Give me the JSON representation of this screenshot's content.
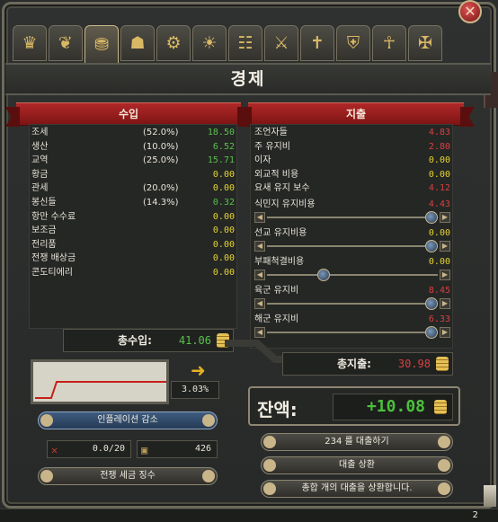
{
  "close_label": "✕",
  "tabs": [
    {
      "icon": "crown-icon",
      "glyph": "♛"
    },
    {
      "icon": "dove-icon",
      "glyph": "❦"
    },
    {
      "icon": "money-bag-icon",
      "glyph": "⛃"
    },
    {
      "icon": "trade-crate-icon",
      "glyph": "☗"
    },
    {
      "icon": "gears-icon",
      "glyph": "⚙"
    },
    {
      "icon": "lightbulb-icon",
      "glyph": "☀"
    },
    {
      "icon": "scroll-icon",
      "glyph": "☷"
    },
    {
      "icon": "arms-icon",
      "glyph": "⚔"
    },
    {
      "icon": "cross-icon",
      "glyph": "✝"
    },
    {
      "icon": "shield-icon",
      "glyph": "⛨"
    },
    {
      "icon": "royal-crest-icon",
      "glyph": "☥"
    },
    {
      "icon": "flag-cross-icon",
      "glyph": "✠"
    }
  ],
  "title": "경제",
  "income": {
    "header": "수입",
    "rows": [
      {
        "label": "조세",
        "pct": "(52.0%)",
        "value": "18.50",
        "color": "green"
      },
      {
        "label": "생산",
        "pct": "(10.0%)",
        "value": "6.52",
        "color": "green"
      },
      {
        "label": "교역",
        "pct": "(25.0%)",
        "value": "15.71",
        "color": "green"
      },
      {
        "label": "황금",
        "pct": "",
        "value": "0.00",
        "color": "yellow"
      },
      {
        "label": "관세",
        "pct": "(20.0%)",
        "value": "0.00",
        "color": "yellow"
      },
      {
        "label": "봉신들",
        "pct": "(14.3%)",
        "value": "0.32",
        "color": "green"
      },
      {
        "label": "항만 수수료",
        "pct": "",
        "value": "0.00",
        "color": "yellow"
      },
      {
        "label": "보조금",
        "pct": "",
        "value": "0.00",
        "color": "yellow"
      },
      {
        "label": "전리품",
        "pct": "",
        "value": "0.00",
        "color": "yellow"
      },
      {
        "label": "전쟁 배상금",
        "pct": "",
        "value": "0.00",
        "color": "yellow"
      },
      {
        "label": "콘도티에리",
        "pct": "",
        "value": "0.00",
        "color": "yellow"
      }
    ],
    "total_label": "총수입:",
    "total_value": "41.06"
  },
  "expense": {
    "header": "지출",
    "rows": [
      {
        "label": "조언자들",
        "value": "4.83",
        "color": "red"
      },
      {
        "label": "주 유지비",
        "value": "2.80",
        "color": "red"
      },
      {
        "label": "이자",
        "value": "0.00",
        "color": "yellow"
      },
      {
        "label": "외교적 비용",
        "value": "0.00",
        "color": "yellow"
      },
      {
        "label": "요새 유지 보수",
        "value": "4.12",
        "color": "red"
      }
    ],
    "slider_rows": [
      {
        "label": "식민지 유지비용",
        "value": "4.43",
        "color": "red",
        "level": 1.0
      },
      {
        "label": "선교 유지비용",
        "value": "0.00",
        "color": "yellow",
        "level": 1.0
      },
      {
        "label": "부패척결비용",
        "value": "0.00",
        "color": "yellow",
        "level": 0.32
      },
      {
        "label": "육군 유지비",
        "value": "8.45",
        "color": "red",
        "level": 1.0
      },
      {
        "label": "해군 유지비",
        "value": "6.33",
        "color": "red",
        "level": 1.0
      }
    ],
    "total_label": "총지출:",
    "total_value": "30.98"
  },
  "inflation": {
    "value": "3.03%",
    "button_label": "인플레이션 감소"
  },
  "balance": {
    "label": "잔액:",
    "value": "+10.08"
  },
  "corruption": {
    "value": "0.0/20"
  },
  "loan_size": {
    "value": "426"
  },
  "buttons": {
    "war_tax": "전쟁 세금 징수",
    "take_loan": "234  를 대출하기",
    "repay_loan": "대출 상환",
    "repay_all": "총합 개의 대출을 상환합니다."
  },
  "page_number": "2",
  "colors": {
    "positive": "#59c04a",
    "zero": "#e6d530",
    "negative": "#d84040",
    "ribbon": "#b02828"
  }
}
